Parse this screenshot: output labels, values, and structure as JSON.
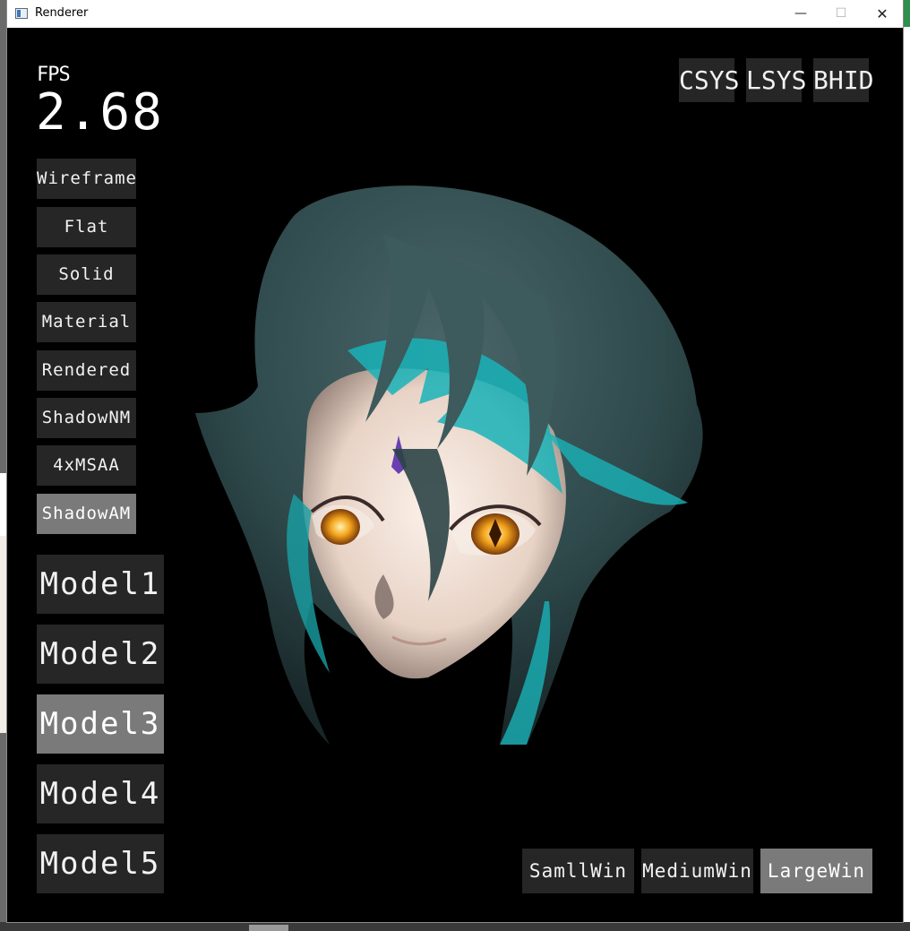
{
  "window": {
    "title": "Renderer"
  },
  "fps": {
    "label": "FPS",
    "value": "2.68"
  },
  "render_modes": [
    {
      "label": "Wireframe",
      "active": false
    },
    {
      "label": "Flat",
      "active": false
    },
    {
      "label": "Solid",
      "active": false
    },
    {
      "label": "Material",
      "active": false
    },
    {
      "label": "Rendered",
      "active": false
    },
    {
      "label": "ShadowNM",
      "active": false
    },
    {
      "label": "4xMSAA",
      "active": false
    },
    {
      "label": "ShadowAM",
      "active": true
    }
  ],
  "models": [
    {
      "label": "Model1",
      "active": false
    },
    {
      "label": "Model2",
      "active": false
    },
    {
      "label": "Model3",
      "active": true
    },
    {
      "label": "Model4",
      "active": false
    },
    {
      "label": "Model5",
      "active": false
    }
  ],
  "toggles": [
    {
      "label": "CSYS"
    },
    {
      "label": "LSYS"
    },
    {
      "label": "BHID"
    }
  ],
  "window_sizes": [
    {
      "label": "SamllWin",
      "active": false
    },
    {
      "label": "MediumWin",
      "active": false
    },
    {
      "label": "LargeWin",
      "active": true
    }
  ],
  "colors": {
    "button_bg": "#262626",
    "button_active_bg": "#7a7a7a",
    "viewport_bg": "#000000",
    "hair": "#2f4a4c",
    "hair_highlight": "#19b3b8",
    "skin": "#f3e4da",
    "eyes": "#f3a31c",
    "forehead_mark": "#6a3fb0"
  }
}
